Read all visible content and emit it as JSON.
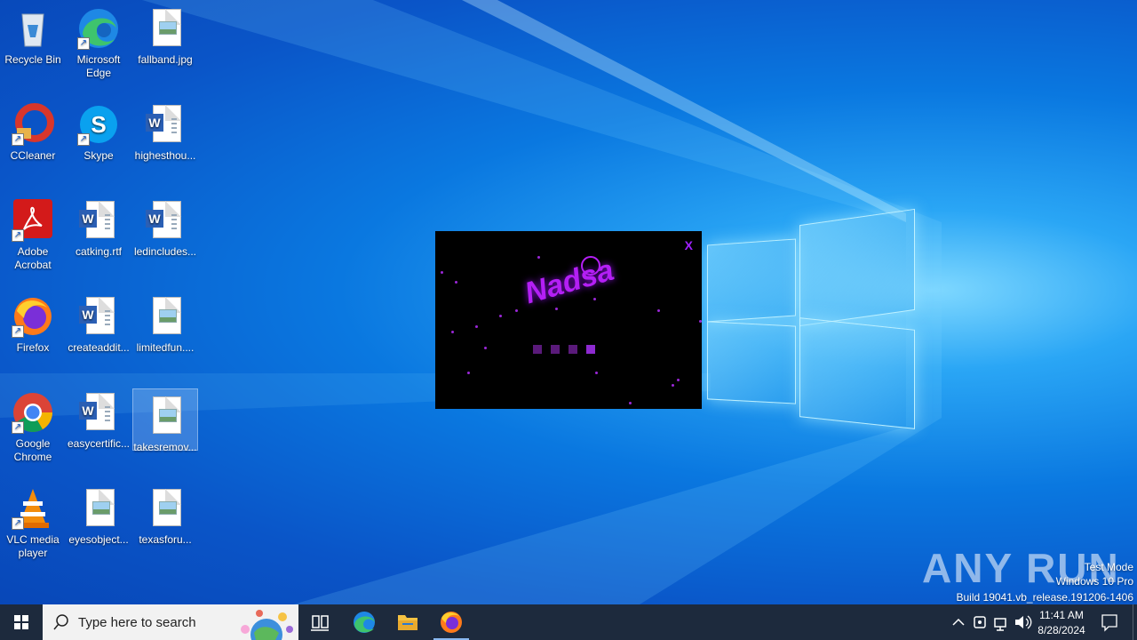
{
  "desktop": {
    "icons": [
      {
        "label": "Recycle Bin"
      },
      {
        "label": "Microsoft Edge"
      },
      {
        "label": "fallband.jpg"
      },
      {
        "label": "CCleaner"
      },
      {
        "label": "Skype"
      },
      {
        "label": "highesthou..."
      },
      {
        "label": "Adobe Acrobat"
      },
      {
        "label": "catking.rtf"
      },
      {
        "label": "ledincludes..."
      },
      {
        "label": "Firefox"
      },
      {
        "label": "createaddit..."
      },
      {
        "label": "limitedfun...."
      },
      {
        "label": "Google Chrome"
      },
      {
        "label": "easycertific..."
      },
      {
        "label": "takesremov..."
      },
      {
        "label": "VLC media player"
      },
      {
        "label": "eyesobject..."
      },
      {
        "label": "texasforu..."
      }
    ]
  },
  "splash": {
    "close_label": "X",
    "brand_text": "Nadsa"
  },
  "watermark": {
    "line1": "Test Mode",
    "line2": "Windows 10 Pro",
    "line3": "Build 19041.vb_release.191206-1406",
    "brand": "ANY RUN"
  },
  "taskbar": {
    "search_placeholder": "Type here to search",
    "time": "11:41 AM",
    "date": "8/28/2024"
  },
  "colors": {
    "accent_purple": "#a020ff",
    "taskbar_bg": "#1d2a3d"
  }
}
